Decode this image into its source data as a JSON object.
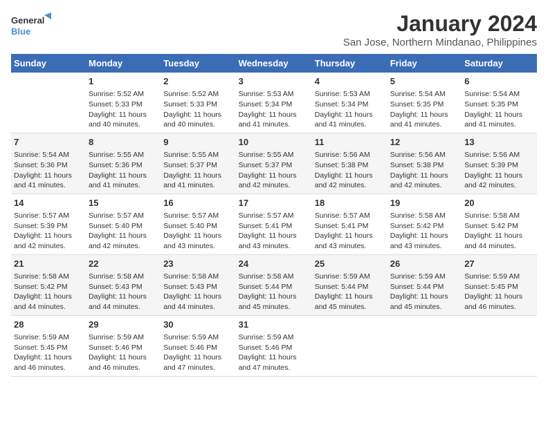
{
  "logo": {
    "line1": "General",
    "line2": "Blue"
  },
  "title": "January 2024",
  "subtitle": "San Jose, Northern Mindanao, Philippines",
  "days_of_week": [
    "Sunday",
    "Monday",
    "Tuesday",
    "Wednesday",
    "Thursday",
    "Friday",
    "Saturday"
  ],
  "weeks": [
    [
      {
        "day": "",
        "info": ""
      },
      {
        "day": "1",
        "info": "Sunrise: 5:52 AM\nSunset: 5:33 PM\nDaylight: 11 hours\nand 40 minutes."
      },
      {
        "day": "2",
        "info": "Sunrise: 5:52 AM\nSunset: 5:33 PM\nDaylight: 11 hours\nand 40 minutes."
      },
      {
        "day": "3",
        "info": "Sunrise: 5:53 AM\nSunset: 5:34 PM\nDaylight: 11 hours\nand 41 minutes."
      },
      {
        "day": "4",
        "info": "Sunrise: 5:53 AM\nSunset: 5:34 PM\nDaylight: 11 hours\nand 41 minutes."
      },
      {
        "day": "5",
        "info": "Sunrise: 5:54 AM\nSunset: 5:35 PM\nDaylight: 11 hours\nand 41 minutes."
      },
      {
        "day": "6",
        "info": "Sunrise: 5:54 AM\nSunset: 5:35 PM\nDaylight: 11 hours\nand 41 minutes."
      }
    ],
    [
      {
        "day": "7",
        "info": "Sunrise: 5:54 AM\nSunset: 5:36 PM\nDaylight: 11 hours\nand 41 minutes."
      },
      {
        "day": "8",
        "info": "Sunrise: 5:55 AM\nSunset: 5:36 PM\nDaylight: 11 hours\nand 41 minutes."
      },
      {
        "day": "9",
        "info": "Sunrise: 5:55 AM\nSunset: 5:37 PM\nDaylight: 11 hours\nand 41 minutes."
      },
      {
        "day": "10",
        "info": "Sunrise: 5:55 AM\nSunset: 5:37 PM\nDaylight: 11 hours\nand 42 minutes."
      },
      {
        "day": "11",
        "info": "Sunrise: 5:56 AM\nSunset: 5:38 PM\nDaylight: 11 hours\nand 42 minutes."
      },
      {
        "day": "12",
        "info": "Sunrise: 5:56 AM\nSunset: 5:38 PM\nDaylight: 11 hours\nand 42 minutes."
      },
      {
        "day": "13",
        "info": "Sunrise: 5:56 AM\nSunset: 5:39 PM\nDaylight: 11 hours\nand 42 minutes."
      }
    ],
    [
      {
        "day": "14",
        "info": "Sunrise: 5:57 AM\nSunset: 5:39 PM\nDaylight: 11 hours\nand 42 minutes."
      },
      {
        "day": "15",
        "info": "Sunrise: 5:57 AM\nSunset: 5:40 PM\nDaylight: 11 hours\nand 42 minutes."
      },
      {
        "day": "16",
        "info": "Sunrise: 5:57 AM\nSunset: 5:40 PM\nDaylight: 11 hours\nand 43 minutes."
      },
      {
        "day": "17",
        "info": "Sunrise: 5:57 AM\nSunset: 5:41 PM\nDaylight: 11 hours\nand 43 minutes."
      },
      {
        "day": "18",
        "info": "Sunrise: 5:57 AM\nSunset: 5:41 PM\nDaylight: 11 hours\nand 43 minutes."
      },
      {
        "day": "19",
        "info": "Sunrise: 5:58 AM\nSunset: 5:42 PM\nDaylight: 11 hours\nand 43 minutes."
      },
      {
        "day": "20",
        "info": "Sunrise: 5:58 AM\nSunset: 5:42 PM\nDaylight: 11 hours\nand 44 minutes."
      }
    ],
    [
      {
        "day": "21",
        "info": "Sunrise: 5:58 AM\nSunset: 5:42 PM\nDaylight: 11 hours\nand 44 minutes."
      },
      {
        "day": "22",
        "info": "Sunrise: 5:58 AM\nSunset: 5:43 PM\nDaylight: 11 hours\nand 44 minutes."
      },
      {
        "day": "23",
        "info": "Sunrise: 5:58 AM\nSunset: 5:43 PM\nDaylight: 11 hours\nand 44 minutes."
      },
      {
        "day": "24",
        "info": "Sunrise: 5:58 AM\nSunset: 5:44 PM\nDaylight: 11 hours\nand 45 minutes."
      },
      {
        "day": "25",
        "info": "Sunrise: 5:59 AM\nSunset: 5:44 PM\nDaylight: 11 hours\nand 45 minutes."
      },
      {
        "day": "26",
        "info": "Sunrise: 5:59 AM\nSunset: 5:44 PM\nDaylight: 11 hours\nand 45 minutes."
      },
      {
        "day": "27",
        "info": "Sunrise: 5:59 AM\nSunset: 5:45 PM\nDaylight: 11 hours\nand 46 minutes."
      }
    ],
    [
      {
        "day": "28",
        "info": "Sunrise: 5:59 AM\nSunset: 5:45 PM\nDaylight: 11 hours\nand 46 minutes."
      },
      {
        "day": "29",
        "info": "Sunrise: 5:59 AM\nSunset: 5:46 PM\nDaylight: 11 hours\nand 46 minutes."
      },
      {
        "day": "30",
        "info": "Sunrise: 5:59 AM\nSunset: 5:46 PM\nDaylight: 11 hours\nand 47 minutes."
      },
      {
        "day": "31",
        "info": "Sunrise: 5:59 AM\nSunset: 5:46 PM\nDaylight: 11 hours\nand 47 minutes."
      },
      {
        "day": "",
        "info": ""
      },
      {
        "day": "",
        "info": ""
      },
      {
        "day": "",
        "info": ""
      }
    ]
  ]
}
